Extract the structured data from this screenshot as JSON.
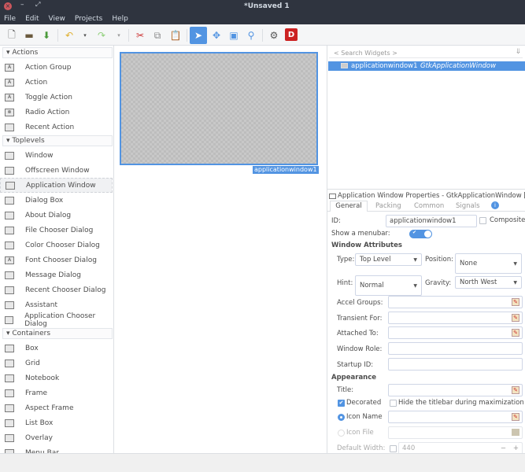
{
  "window": {
    "title": "*Unsaved 1"
  },
  "menu": [
    "File",
    "Edit",
    "View",
    "Projects",
    "Help"
  ],
  "toolbar": {
    "icons": [
      "new-icon",
      "open-icon",
      "save-icon",
      "undo-icon",
      "undo-dropdown-icon",
      "redo-icon",
      "redo-dropdown-icon",
      "cut-icon",
      "copy-icon",
      "paste-icon",
      "select-pointer-icon",
      "drag-resize-icon",
      "margin-edit-icon",
      "alignment-edit-icon",
      "gears-icon",
      "devhelp-icon"
    ]
  },
  "palette": {
    "groups": [
      {
        "label": "Actions",
        "items": [
          "Action Group",
          "Action",
          "Toggle Action",
          "Radio Action",
          "Recent Action"
        ]
      },
      {
        "label": "Toplevels",
        "items": [
          "Window",
          "Offscreen Window",
          "Application Window",
          "Dialog Box",
          "About Dialog",
          "File Chooser Dialog",
          "Color Chooser Dialog",
          "Font Chooser Dialog",
          "Message Dialog",
          "Recent Chooser Dialog",
          "Assistant",
          "Application Chooser Dialog"
        ]
      },
      {
        "label": "Containers",
        "items": [
          "Box",
          "Grid",
          "Notebook",
          "Frame",
          "Aspect Frame",
          "List Box",
          "Overlay",
          "Menu Bar"
        ]
      }
    ],
    "selected": "Application Window"
  },
  "canvas": {
    "widget_label": "applicationwindow1"
  },
  "inspector": {
    "search_placeholder": "< Search Widgets >",
    "tree": [
      {
        "name": "applicationwindow1",
        "type": "GtkApplicationWindow"
      }
    ]
  },
  "properties": {
    "header": "Application Window Properties - GtkApplicationWindow [a...",
    "tabs": [
      "General",
      "Packing",
      "Common",
      "Signals"
    ],
    "active_tab": "General",
    "id_label": "ID:",
    "id_value": "applicationwindow1",
    "composite_label": "Composite",
    "composite_checked": false,
    "menubar_label": "Show a menubar:",
    "menubar_on": true,
    "window_attributes": "Window Attributes",
    "type_label": "Type:",
    "type_value": "Top Level",
    "position_label": "Position:",
    "position_value": "None",
    "hint_label": "Hint:",
    "hint_value": "Normal",
    "gravity_label": "Gravity:",
    "gravity_value": "North West",
    "accel_groups": "Accel Groups:",
    "transient_for": "Transient For:",
    "attached_to": "Attached To:",
    "window_role": "Window Role:",
    "startup_id": "Startup ID:",
    "appearance": "Appearance",
    "title_label": "Title:",
    "decorated_label": "Decorated",
    "decorated_checked": true,
    "hide_titlebar_label": "Hide the titlebar during maximization",
    "hide_titlebar_checked": false,
    "icon_name_label": "Icon Name",
    "icon_file_label": "Icon File",
    "default_width_label": "Default Width:",
    "default_width_value": "440"
  },
  "colors": {
    "accent": "#5294e2",
    "titlebar": "#2f343f"
  }
}
